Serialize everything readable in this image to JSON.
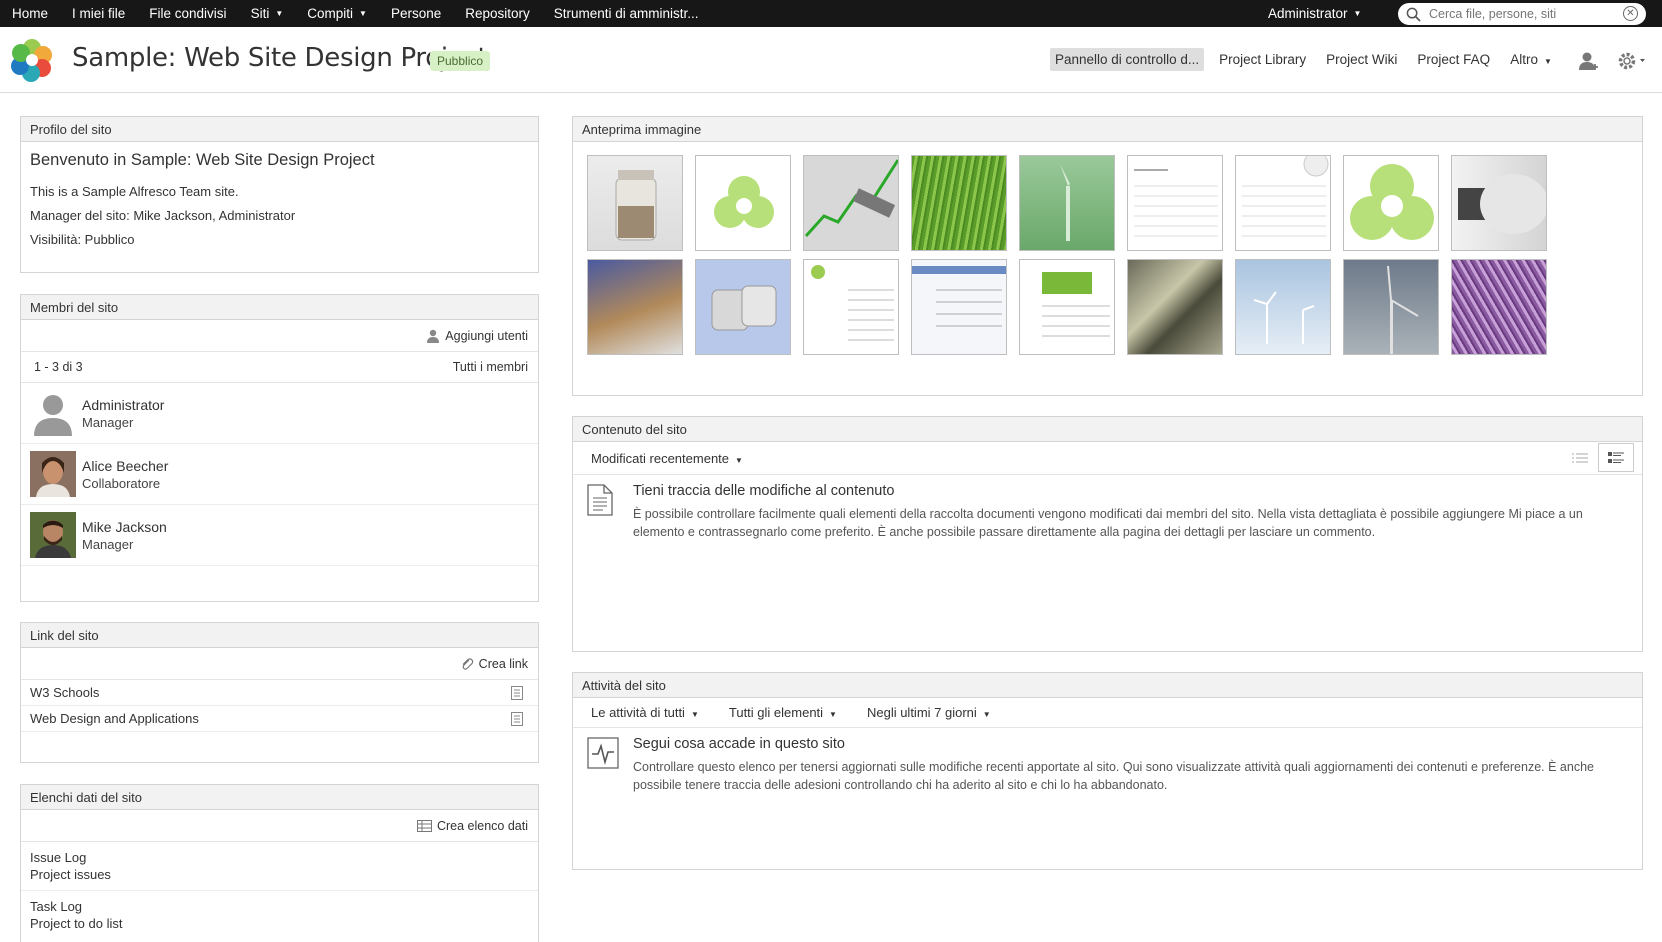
{
  "topnav": {
    "items": [
      "Home",
      "I miei file",
      "File condivisi",
      "Siti",
      "Compiti",
      "Persone",
      "Repository",
      "Strumenti di amministr..."
    ],
    "user": "Administrator",
    "search_placeholder": "Cerca file, persone, siti"
  },
  "header": {
    "title": "Sample: Web Site Design Project",
    "visibility_badge": "Pubblico",
    "nav": [
      "Pannello di controllo d...",
      "Project Library",
      "Project Wiki",
      "Project FAQ",
      "Altro"
    ]
  },
  "profile": {
    "title": "Profilo del sito",
    "welcome": "Benvenuto in Sample: Web Site Design Project",
    "description": "This is a Sample Alfresco Team site.",
    "manager": "Manager del sito: Mike Jackson, Administrator",
    "visibility": "Visibilità: Pubblico"
  },
  "members": {
    "title": "Membri del sito",
    "add_users": "Aggiungi utenti",
    "count": "1 - 3 di 3",
    "all_members": "Tutti i membri",
    "list": [
      {
        "name": "Administrator",
        "role": "Manager"
      },
      {
        "name": "Alice Beecher",
        "role": "Collaboratore"
      },
      {
        "name": "Mike Jackson",
        "role": "Manager"
      }
    ]
  },
  "links": {
    "title": "Link del sito",
    "create": "Crea link",
    "items": [
      "W3 Schools",
      "Web Design and Applications"
    ]
  },
  "datalists": {
    "title": "Elenchi dati del sito",
    "create": "Crea elenco dati",
    "items": [
      {
        "name": "Issue Log",
        "desc": "Project issues"
      },
      {
        "name": "Task Log",
        "desc": "Project to do list"
      }
    ]
  },
  "image_preview": {
    "title": "Anteprima immagine",
    "images": [
      "coins-jar",
      "alfresco-logo",
      "growth-chart",
      "grass",
      "wind-turbine-green",
      "document-form",
      "document-form-2",
      "alfresco-logo-large",
      "light-bulb",
      "coins-stack",
      "power-adapter",
      "webpage-green",
      "webpage-blue",
      "webpage-grass",
      "turbine-blades",
      "wind-farm",
      "wind-turbine-sky",
      "cables"
    ]
  },
  "site_content": {
    "title": "Contenuto del sito",
    "filter": "Modificati recentemente",
    "empty_title": "Tieni traccia delle modifiche al contenuto",
    "empty_text": "È possibile controllare facilmente quali elementi della raccolta documenti vengono modificati dai membri del sito. Nella vista dettagliata è possibile aggiungere Mi piace a un elemento e contrassegnarlo come preferito. È anche possibile passare direttamente alla pagina dei dettagli per lasciare un commento."
  },
  "activities": {
    "title": "Attività del sito",
    "filters": [
      "Le attività di tutti",
      "Tutti gli elementi",
      "Negli ultimi 7 giorni"
    ],
    "empty_title": "Segui cosa accade in questo sito",
    "empty_text": "Controllare questo elenco per tenersi aggiornati sulle modifiche recenti apportate al sito. Qui sono visualizzate attività quali aggiornamenti dei contenuti e preferenze. È anche possibile tenere traccia delle adesioni controllando chi ha aderito al sito e chi lo ha abbandonato."
  }
}
